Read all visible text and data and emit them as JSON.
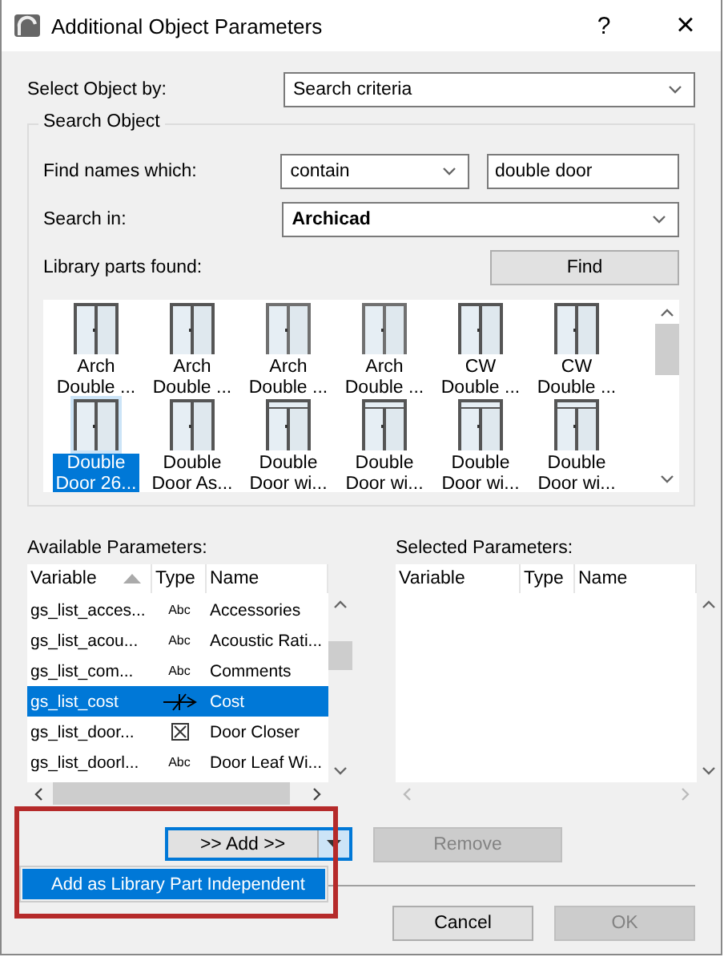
{
  "window": {
    "title": "Additional Object Parameters",
    "help": "?",
    "close": "×"
  },
  "select_by": {
    "label": "Select Object by:",
    "value": "Search criteria"
  },
  "search_object": {
    "legend": "Search Object",
    "find_names": {
      "label": "Find names which:",
      "mode": "contain",
      "text": "double door"
    },
    "search_in": {
      "label": "Search in:",
      "value": "Archicad"
    },
    "found_label": "Library parts found:",
    "find_button": "Find",
    "parts": [
      {
        "lines": [
          "Arch",
          "Double ..."
        ],
        "selected": false
      },
      {
        "lines": [
          "Arch",
          "Double ..."
        ],
        "selected": false
      },
      {
        "lines": [
          "Arch",
          "Double ..."
        ],
        "selected": false
      },
      {
        "lines": [
          "Arch",
          "Double ..."
        ],
        "selected": false
      },
      {
        "lines": [
          "CW",
          "Double ..."
        ],
        "selected": false
      },
      {
        "lines": [
          "CW",
          "Double ..."
        ],
        "selected": false
      },
      {
        "lines": [
          "Double",
          "Door 26..."
        ],
        "selected": true
      },
      {
        "lines": [
          "Double",
          "Door As..."
        ],
        "selected": false
      },
      {
        "lines": [
          "Double",
          "Door wi..."
        ],
        "selected": false
      },
      {
        "lines": [
          "Double",
          "Door wi..."
        ],
        "selected": false
      },
      {
        "lines": [
          "Double",
          "Door wi..."
        ],
        "selected": false
      },
      {
        "lines": [
          "Double",
          "Door wi..."
        ],
        "selected": false
      }
    ]
  },
  "available": {
    "label": "Available Parameters:",
    "columns": [
      {
        "label": "Variable",
        "sorted": true
      },
      {
        "label": "Type",
        "sorted": false
      },
      {
        "label": "Name",
        "sorted": false
      }
    ],
    "rows": [
      {
        "variable": "gs_list_acces...",
        "kind": "text",
        "type": "Abc",
        "name": "Accessories",
        "selected": false
      },
      {
        "variable": "gs_list_acou...",
        "kind": "text",
        "type": "Abc",
        "name": "Acoustic Rati...",
        "selected": false
      },
      {
        "variable": "gs_list_com...",
        "kind": "text",
        "type": "Abc",
        "name": "Comments",
        "selected": false
      },
      {
        "variable": "gs_list_cost",
        "kind": "length",
        "name": "Cost",
        "selected": true
      },
      {
        "variable": "gs_list_door...",
        "kind": "boolean",
        "name": "Door Closer",
        "selected": false
      },
      {
        "variable": "gs_list_doorl...",
        "kind": "text",
        "type": "Abc",
        "name": "Door Leaf Wi...",
        "selected": false
      }
    ]
  },
  "selected_params": {
    "label": "Selected Parameters:",
    "columns": [
      {
        "label": "Variable",
        "sorted": false
      },
      {
        "label": "Type",
        "sorted": false
      },
      {
        "label": "Name",
        "sorted": false
      }
    ]
  },
  "add_button": {
    "label": ">> Add >>",
    "focused": true
  },
  "add_menu": [
    {
      "label": "Add as Library Part Independent",
      "selected": true
    }
  ],
  "remove_button": {
    "label": "Remove",
    "disabled": true
  },
  "buttons": [
    {
      "label": "Cancel",
      "disabled": false
    },
    {
      "label": "OK",
      "disabled": true
    }
  ]
}
